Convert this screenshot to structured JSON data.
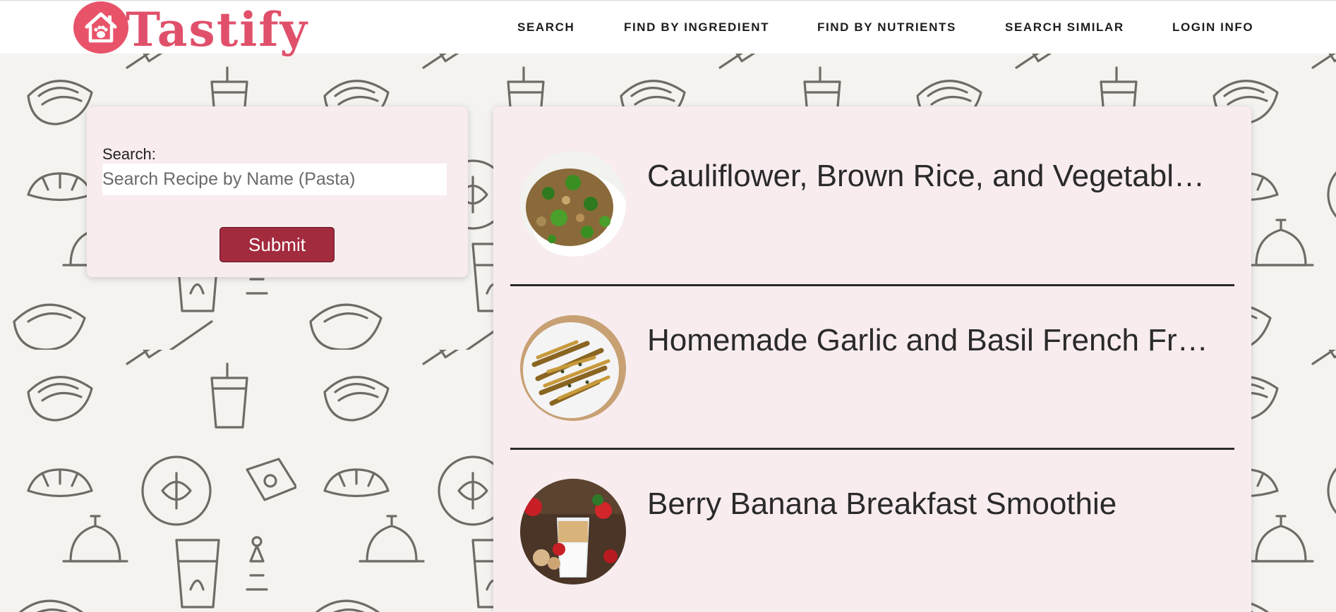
{
  "brand": {
    "name": "Tastify",
    "color": "#e0506a"
  },
  "nav": {
    "items": [
      {
        "label": "SEARCH"
      },
      {
        "label": "FIND BY INGREDIENT"
      },
      {
        "label": "FIND BY NUTRIENTS"
      },
      {
        "label": "SEARCH SIMILAR"
      },
      {
        "label": "LOGIN INFO"
      }
    ]
  },
  "search": {
    "label": "Search:",
    "placeholder": "Search Recipe by Name (Pasta)",
    "value": "",
    "submit_label": "Submit"
  },
  "results": [
    {
      "title": "Cauliflower, Brown Rice, and Vegetable Fried Rice",
      "image": "cauliflower-rice-photo"
    },
    {
      "title": "Homemade Garlic and Basil French Fries",
      "image": "garlic-fries-photo"
    },
    {
      "title": "Berry Banana Breakfast Smoothie",
      "image": "berry-smoothie-photo"
    }
  ],
  "colors": {
    "accent": "#a32b3e",
    "card_background": "#f8ecee",
    "page_background": "#f4f3f0"
  }
}
